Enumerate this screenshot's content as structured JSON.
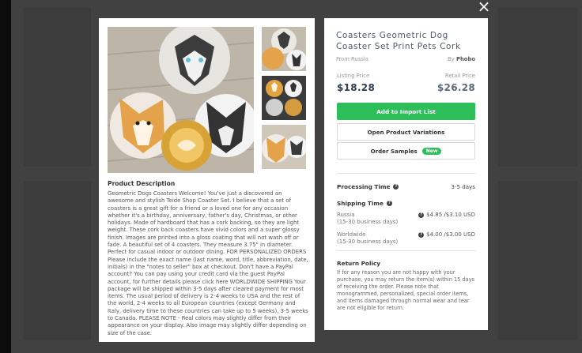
{
  "modal": {
    "close_label": "×"
  },
  "product": {
    "title": "Coasters Geometric Dog Coaster Set Print Pets Cork",
    "from": "From Russia",
    "by_prefix": "By",
    "seller": "Phobo",
    "listing_price_label": "Listing Price",
    "listing_price": "$18.28",
    "retail_price_label": "Retail Price",
    "retail_price": "$26.28"
  },
  "actions": {
    "add_to_import": "Add to Import List",
    "open_variations": "Open Product Variations",
    "order_samples": "Order Samples",
    "new_badge": "New"
  },
  "processing": {
    "label": "Processing Time",
    "value": "3-5 days"
  },
  "shipping": {
    "label": "Shipping Time",
    "rows": [
      {
        "name": "Russia",
        "time": "(15-30 business days)",
        "price": "$4.85 /$3.10 USD"
      },
      {
        "name": "Worldwide",
        "time": "(15-30 business days)",
        "price": "$4.00 /$3.00 USD"
      }
    ]
  },
  "return_policy": {
    "label": "Return Policy",
    "text": "If for any reason you are not happy with your purchase, you may return the item(s) within 15 days of receiving the order. Please note that monogrammed, personalized, special order items, and items damaged through normal wear and tear are not eligible for return."
  },
  "description": {
    "title": "Product Description",
    "text": "Geometric Dogs Coasters Welcome! You've just a discovered an awesome and stylish Teide Shop Coaster Set. I believe that a set of coasters is a great gift for a friend or a loved one for any occasion whether it's a birthday, anniversary, father's day, Christmas, or other holidays. Made of hardboard that has a cork backing, so they are light weight. These cork back coasters have vivid colors and a super glossy finish. Images are printed into a gloss coating that will not wash off or fade. A beautiful set of 4 coasters. They measure 3.75\" in diameter. Perfect for casual indoor or outdoor dining. FOR PERSONALIZED ORDERS Please include the exact name (last name, word, title, abbreviation, date, initials) in the \"notes to seller\" box at checkout. Don't have a PayPal account? You can pay using your credit card via the guest PayPal account, for further details please click here WORLDWIDE SHIPPING Your package will be shipped within 3-5 days after cleared payment for most items. The usual period of delivery is 2-4 weeks to USA and the rest of the world, 2-4 weeks to all European countries (except Germany and Italy, delivery time to these countries can take up to 5 weeks), 3-5 weeks to Canada. PLEASE NOTE - Real colors may slightly differ from their appearance on your display. Also image may slightly differ depending on size of the case."
  },
  "colors": {
    "green": "#2fbf5a",
    "title_blue": "#4a5a6a",
    "overlay": "rgba(0,0,0,0.72)"
  }
}
